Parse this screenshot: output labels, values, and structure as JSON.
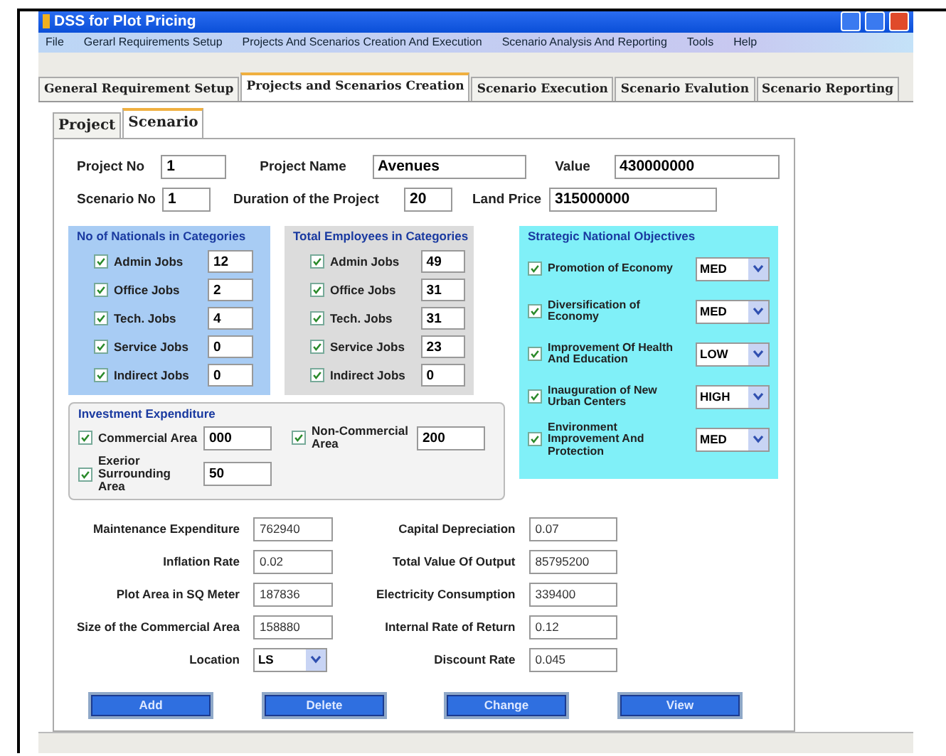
{
  "window": {
    "title": "DSS for Plot Pricing"
  },
  "menu": [
    "File",
    "Gerarl Requirements Setup",
    "Projects And Scenarios Creation And Execution",
    "Scenario Analysis And Reporting",
    "Tools",
    "Help"
  ],
  "main_tabs": [
    {
      "label": "General Requirement Setup",
      "selected": false
    },
    {
      "label": "Projects and Scenarios Creation",
      "selected": true
    },
    {
      "label": "Scenario Execution",
      "selected": false
    },
    {
      "label": "Scenario Evalution",
      "selected": false
    },
    {
      "label": "Scenario Reporting",
      "selected": false
    }
  ],
  "sub_tabs": [
    {
      "label": "Project",
      "selected": false
    },
    {
      "label": "Scenario",
      "selected": true
    }
  ],
  "header_fields": [
    {
      "label": "Project No",
      "value": "1"
    },
    {
      "label": "Project Name",
      "value": "Avenues"
    },
    {
      "label": "Value",
      "value": "430000000"
    },
    {
      "label": "Scenario No",
      "value": "1"
    },
    {
      "label": "Duration of the Project",
      "value": "20"
    },
    {
      "label": "Land Price",
      "value": "315000000"
    }
  ],
  "nationals": {
    "title": "No of Nationals in Categories",
    "items": [
      {
        "label": "Admin Jobs",
        "checked": true,
        "value": "12"
      },
      {
        "label": "Office Jobs",
        "checked": true,
        "value": "2"
      },
      {
        "label": "Tech. Jobs",
        "checked": true,
        "value": "4"
      },
      {
        "label": "Service Jobs",
        "checked": true,
        "value": "0"
      },
      {
        "label": "Indirect Jobs",
        "checked": true,
        "value": "0"
      }
    ]
  },
  "employees": {
    "title": "Total Employees  in Categories",
    "items": [
      {
        "label": "Admin Jobs",
        "checked": true,
        "value": "49"
      },
      {
        "label": "Office Jobs",
        "checked": true,
        "value": "31"
      },
      {
        "label": "Tech. Jobs",
        "checked": true,
        "value": "31"
      },
      {
        "label": "Service Jobs",
        "checked": true,
        "value": "23"
      },
      {
        "label": "Indirect Jobs",
        "checked": true,
        "value": "0"
      }
    ]
  },
  "investment": {
    "title": "Investment Expenditure",
    "items": [
      {
        "label": "Commercial Area",
        "checked": true,
        "value": "000"
      },
      {
        "label": "Non-Commercial Area",
        "checked": true,
        "value": "200"
      },
      {
        "label": "Exerior Surrounding Area",
        "checked": true,
        "value": "50"
      }
    ]
  },
  "strategic": {
    "title": "Strategic National Objectives",
    "items": [
      {
        "label": "Promotion of Economy",
        "checked": true,
        "value": "MED"
      },
      {
        "label": "Diversification of Economy",
        "checked": true,
        "value": "MED"
      },
      {
        "label": "Improvement Of Health And Education",
        "checked": true,
        "value": "LOW"
      },
      {
        "label": "Inauguration of New Urban Centers",
        "checked": true,
        "value": "HIGH"
      },
      {
        "label": "Environment Improvement And Protection",
        "checked": true,
        "value": "MED"
      }
    ]
  },
  "details_left": [
    {
      "label": "Maintenance Expenditure",
      "value": "762940",
      "kind": "text"
    },
    {
      "label": "Inflation Rate",
      "value": "0.02",
      "kind": "text"
    },
    {
      "label": "Plot Area in SQ Meter",
      "value": "187836",
      "kind": "text"
    },
    {
      "label": "Size of the Commercial Area",
      "value": "158880",
      "kind": "text"
    },
    {
      "label": "Location",
      "value": "LS",
      "kind": "select"
    }
  ],
  "details_right": [
    {
      "label": "Capital Depreciation",
      "value": "0.07"
    },
    {
      "label": "Total Value Of Output",
      "value": "85795200"
    },
    {
      "label": "Electricity Consumption",
      "value": "339400"
    },
    {
      "label": "Internal Rate of Return",
      "value": "0.12"
    },
    {
      "label": "Discount Rate",
      "value": "0.045"
    }
  ],
  "buttons": [
    "Add",
    "Delete",
    "Change",
    "View"
  ]
}
